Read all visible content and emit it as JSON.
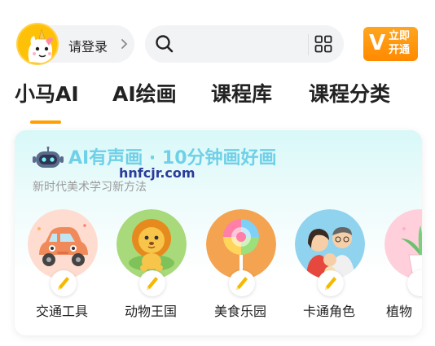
{
  "header": {
    "login_label": "请登录",
    "vip_line1": "立即",
    "vip_line2": "开通",
    "vip_letter": "V",
    "accent_color": "#ff9500"
  },
  "tabs": [
    {
      "label": "小马AI",
      "active": true
    },
    {
      "label": "AI绘画",
      "active": false
    },
    {
      "label": "课程库",
      "active": false
    },
    {
      "label": "课程分类",
      "active": false
    }
  ],
  "card": {
    "title": "AI有声画 · 10分钟画好画",
    "subtitle": "新时代美术学习新方法",
    "watermark": "hnfcjr.com",
    "categories": [
      {
        "label": "交通工具",
        "icon": "toy-car-icon"
      },
      {
        "label": "动物王国",
        "icon": "lion-icon"
      },
      {
        "label": "美食乐园",
        "icon": "lollipop-icon"
      },
      {
        "label": "卡通角色",
        "icon": "cartoon-family-icon"
      },
      {
        "label": "植物",
        "icon": "plant-icon"
      }
    ]
  }
}
